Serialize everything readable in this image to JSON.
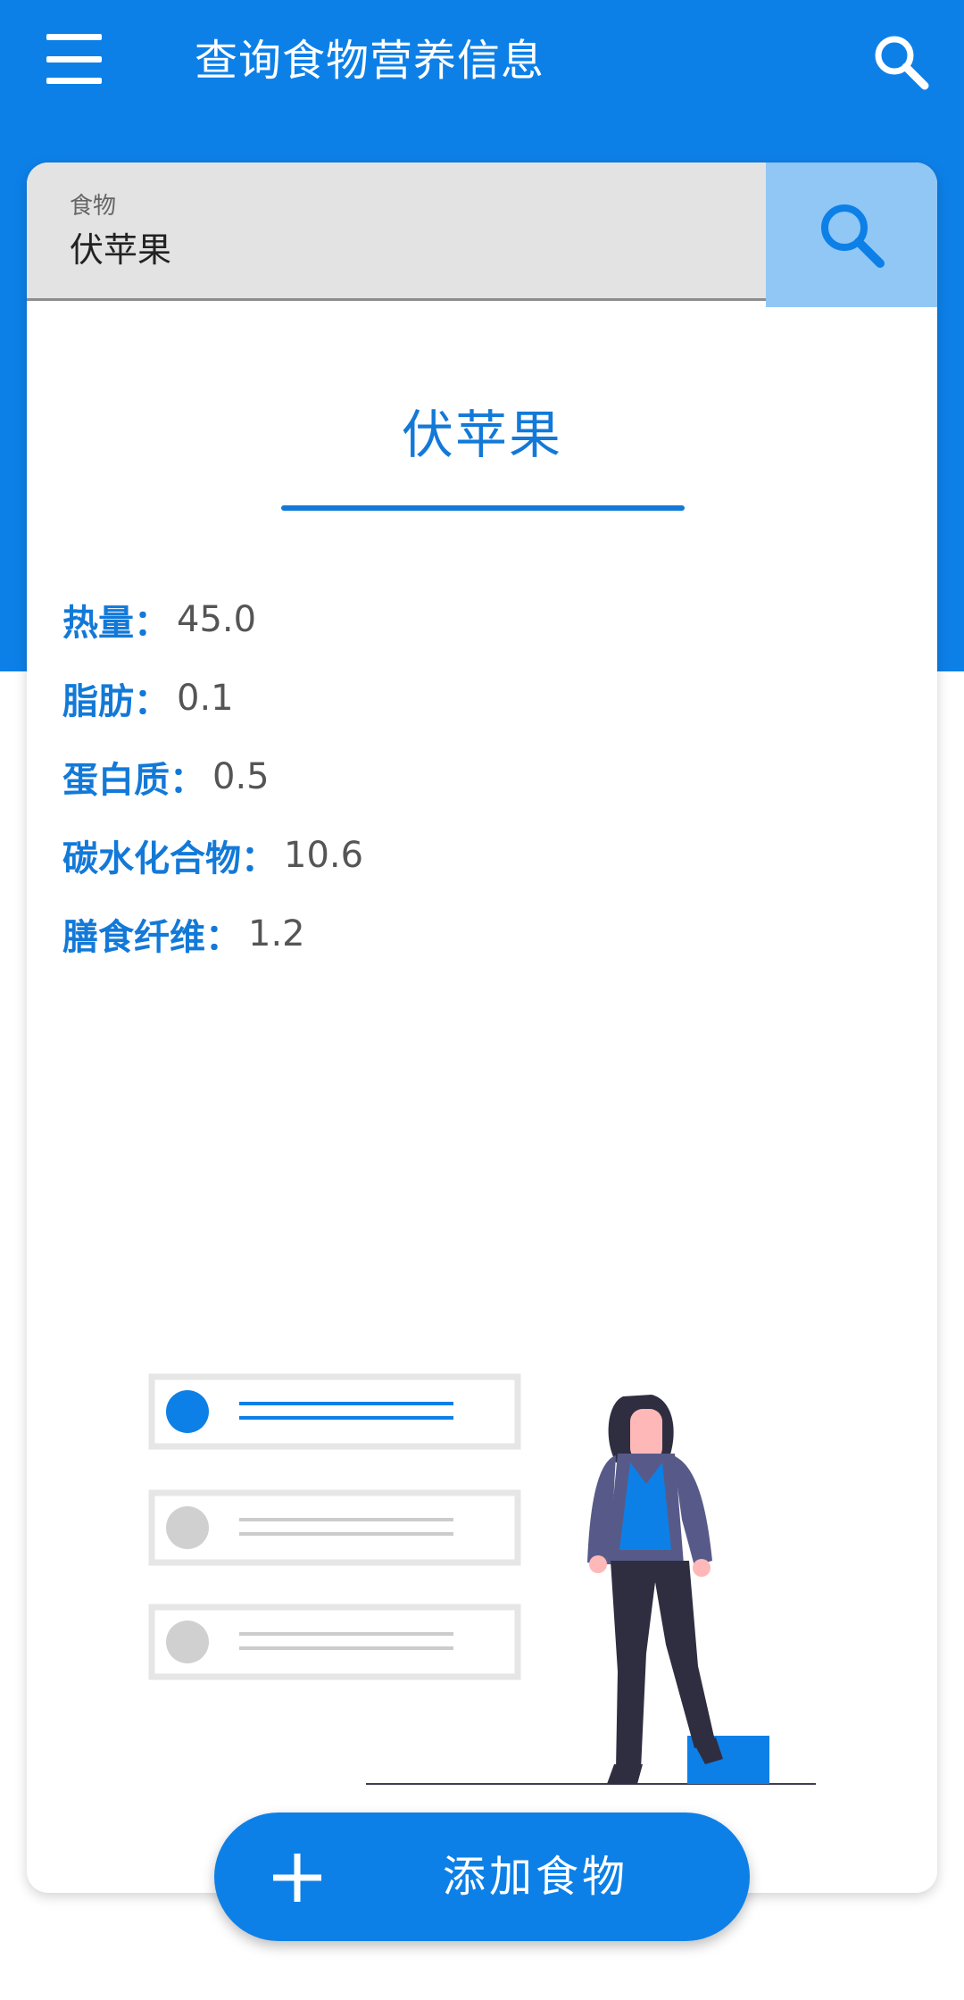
{
  "appbar": {
    "title": "查询食物营养信息",
    "menu_icon": "menu-icon",
    "search_icon": "search-icon"
  },
  "search": {
    "label": "食物",
    "value": "伏苹果",
    "button_icon": "search-icon"
  },
  "result": {
    "food_name": "伏苹果",
    "nutrients": [
      {
        "label": "热量：",
        "value": "45.0"
      },
      {
        "label": "脂肪：",
        "value": "0.1"
      },
      {
        "label": "蛋白质：",
        "value": "0.5"
      },
      {
        "label": "碳水化合物：",
        "value": "10.6"
      },
      {
        "label": "膳食纤维：",
        "value": "1.2"
      }
    ]
  },
  "fab": {
    "label": "添加食物",
    "icon": "plus-icon"
  },
  "colors": {
    "primary": "#0d80e8",
    "accent_text": "#1379d8",
    "search_button_bg": "#90c7f5",
    "field_bg": "#e3e3e3"
  }
}
